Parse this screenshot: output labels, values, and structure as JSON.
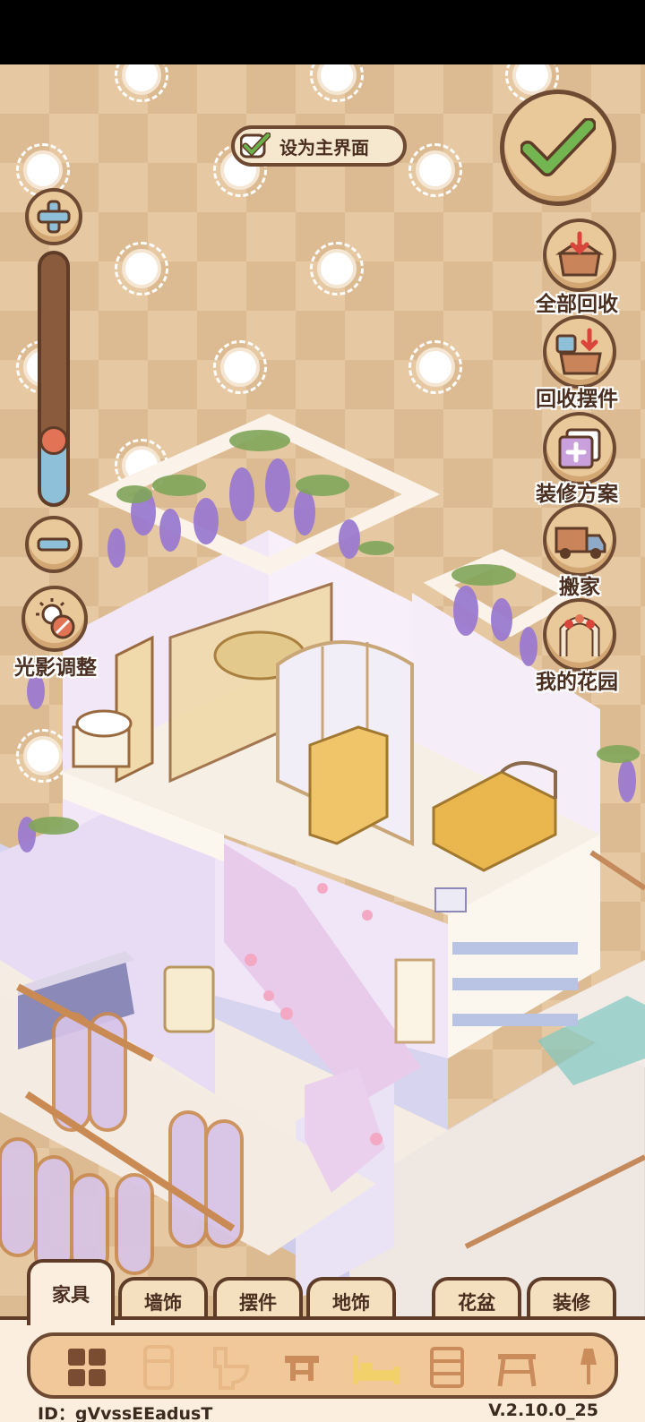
{
  "toggle": {
    "label": "设为主界面"
  },
  "side_buttons": [
    {
      "label": "全部回收",
      "icon": "recycle-all-box-icon"
    },
    {
      "label": "回收摆件",
      "icon": "recycle-ornaments-box-icon"
    },
    {
      "label": "装修方案",
      "icon": "decoration-plan-icon"
    },
    {
      "label": "搬家",
      "icon": "moving-truck-icon"
    },
    {
      "label": "我的花园",
      "icon": "garden-arch-icon"
    }
  ],
  "lighting": {
    "label": "光影调整",
    "icon": "sun-adjust-icon"
  },
  "zoom": {
    "level": 0.25
  },
  "tabs": [
    {
      "label": "家具"
    },
    {
      "label": "墙饰"
    },
    {
      "label": "摆件"
    },
    {
      "label": "地饰"
    },
    {
      "label": "花盆"
    },
    {
      "label": "装修"
    }
  ],
  "categories": [
    "all-grid-icon",
    "fridge-icon",
    "toilet-icon",
    "table-icon",
    "bed-icon",
    "cabinet-icon",
    "desk-icon",
    "lamp-icon"
  ],
  "footer": {
    "id": "ID：gVvssEEadusT",
    "version": "V.2.10.0_25"
  },
  "colors": {
    "accent": "#5e3c28",
    "panel": "#fbeede",
    "check": "#6bb04a"
  }
}
